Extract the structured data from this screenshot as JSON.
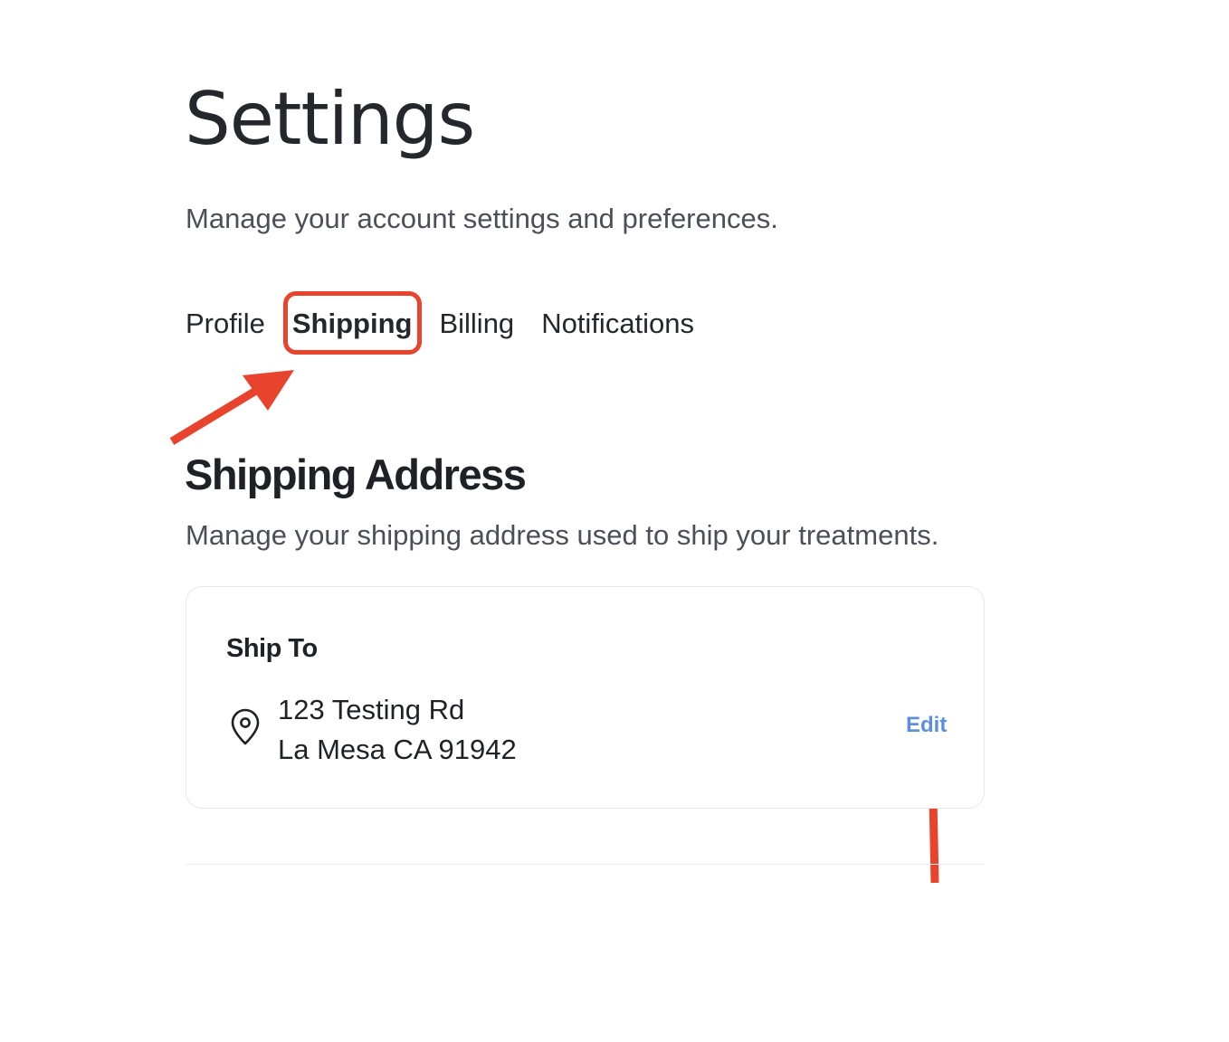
{
  "header": {
    "title": "Settings",
    "subtitle": "Manage your account settings and preferences."
  },
  "tabs": [
    {
      "label": "Profile",
      "active": false
    },
    {
      "label": "Shipping",
      "active": true
    },
    {
      "label": "Billing",
      "active": false
    },
    {
      "label": "Notifications",
      "active": false
    }
  ],
  "section": {
    "title": "Shipping Address",
    "subtitle": "Manage your shipping address used to ship your treatments."
  },
  "card": {
    "title": "Ship To",
    "icon": "map-pin-icon",
    "address_line1": "123 Testing Rd",
    "address_line2": "La Mesa CA 91942",
    "edit_label": "Edit"
  },
  "colors": {
    "annotation": "#e8432c",
    "link": "#5b8fdc",
    "text": "#1f2126",
    "muted": "#4b4f57"
  }
}
